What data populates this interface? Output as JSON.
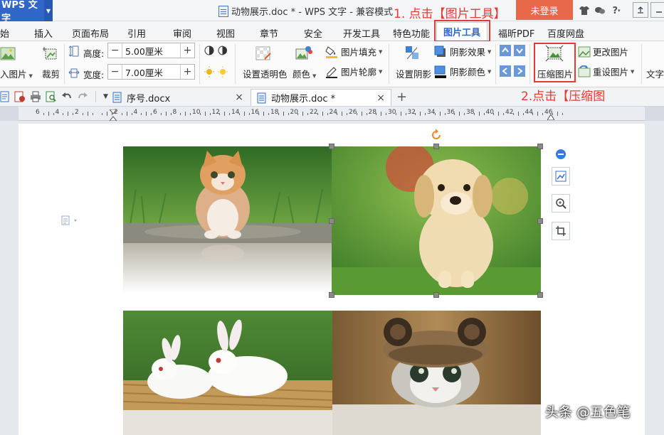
{
  "titlebar": {
    "app_name": "WPS 文字",
    "doc_title": "动物展示.doc * - WPS 文字 - 兼容模式",
    "annotation_1": "1. 点击【图片工具】",
    "login_label": "未登录",
    "help_label": "?"
  },
  "menu": {
    "tabs": [
      "始",
      "插入",
      "页面布局",
      "引用",
      "审阅",
      "视图",
      "章节",
      "安全",
      "开发工具",
      "特色功能",
      "图片工具",
      "福昕PDF",
      "百度网盘"
    ],
    "active": "图片工具"
  },
  "ribbon": {
    "insert_picture_label": "入图片",
    "crop_label": "裁剪",
    "height_label": "高度:",
    "height_value": "5.00厘米",
    "width_label": "宽度:",
    "width_value": "7.00厘米",
    "transparent_label": "设置透明色",
    "color_label": "颜色",
    "fill_label": "图片填充",
    "outline_label": "图片轮廓",
    "shadow_label": "设置阴影",
    "shadow_effect_label": "阴影效果",
    "shadow_color_label": "阴影颜色",
    "compress_label": "压缩图片",
    "change_label": "更改图片",
    "reset_label": "重设图片",
    "text_label": "文字",
    "minus": "−",
    "plus": "+"
  },
  "annotation_2": "2.点击【压缩图",
  "doc_tabs": [
    {
      "name": "序号.docx",
      "close": "×"
    },
    {
      "name": "动物展示.doc *",
      "close": "×"
    }
  ],
  "new_tab": "+",
  "ruler": {
    "labels": [
      "6",
      "4",
      "2",
      "",
      "2",
      "4",
      "6",
      "8",
      "10",
      "12",
      "14",
      "16",
      "18",
      "20",
      "22",
      "24",
      "26",
      "28",
      "30",
      "32",
      "34",
      "36",
      "38",
      "40",
      "42",
      "44",
      "46"
    ]
  },
  "photos": [
    {
      "subject": "kitten"
    },
    {
      "subject": "puppy"
    },
    {
      "subject": "rabbits"
    },
    {
      "subject": "cat-in-hat"
    }
  ],
  "watermark": "头条 @五色笔",
  "colors": {
    "accent": "#2f66c7",
    "annotation_red": "#e53935",
    "login_orange": "#e8694a"
  }
}
